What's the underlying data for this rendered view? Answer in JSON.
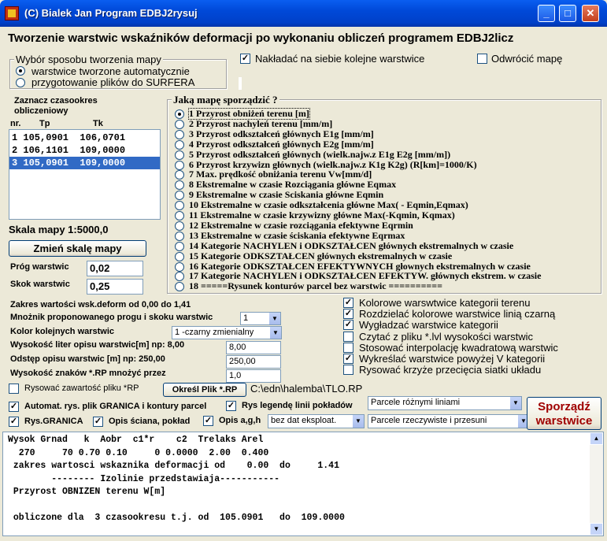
{
  "window": {
    "title": "(C) Bialek Jan Program EDBJ2rysuj",
    "min": "_",
    "max": "□",
    "close": "✕"
  },
  "heading": "Tworzenie warstwic wskaźników deformacji po wykonaniu obliczeń programem EDBJ2licz",
  "map_method": {
    "legend": "Wybór sposobu tworzenia mapy",
    "options": [
      "warstwice tworzone automatycznie",
      "przygotowanie plików do SURFERA"
    ],
    "selected": 0
  },
  "overlay_check": {
    "label": "Nakładać na siebie kolejne  warstwice",
    "checked": true
  },
  "flip_check": {
    "label": "Odwrócić mapę",
    "checked": false
  },
  "periods": {
    "label": "Zaznacz czasookres obliczeniowy",
    "headers": [
      "nr.",
      "Tp",
      "Tk"
    ],
    "rows": [
      "1 105,0901  106,0701",
      "2 106,1101  109,0000",
      "3 105,0901  109,0000"
    ],
    "selected": 2
  },
  "scale": {
    "label": "Skala mapy 1:5000,0",
    "button": "Zmień skalę mapy"
  },
  "threshold": {
    "label": "Próg warstwic",
    "value": "0,02"
  },
  "step": {
    "label": "Skok warstwic",
    "value": "0,25"
  },
  "map_type": {
    "legend": "Jaką mapę sporządzić ?",
    "options": [
      "1   Przyrost obniżeń terenu [m]",
      "2   Przyrost nachyleń terenu [mm/m]",
      "3   Przyrost odkształceń głównych E1g [mm/m]",
      "4   Przyrost odkształceń głównych E2g [mm/m]",
      "5   Przyrost odkształceń głównych (wielk.najw.z E1g E2g [mm/m])",
      "6   Przyrost krzywizn głównych (wielk.najw.z K1g K2g)           (R[km]=1000/K)",
      "7   Max. prędkość obniżania terenu Vw[mm/d]",
      "8   Ekstremalne w czasie Rozciągania główne Eqmax",
      "9   Ekstremalne w czasie Sciskania     główne Eqmin",
      "10 Ekstremalne w czasie odkształcenia główne    Max( - Eqmin,Eqmax)",
      "11 Ekstremalne w czasie krzywizny główne    Max(-Kqmin, Kqmax)",
      "12 Ekstremalne w czasie rozciągania efektywne Eqrmin",
      "13 Ekstremalne w  czasie  ściskania  efektywne  Eqrmax",
      "14 Kategorie NACHYLEN i ODKSZTAŁCEN głównych ekstremalnych w czasie",
      "15 Kategorie ODKSZTAŁCEN głównych ekstremalnych w czasie",
      "16 Kategorie ODKSZTAŁCEN EFEKTYWNYCH głownych ekstremalnych w czasie",
      "17 Kategorie NACHYLEN i ODKSZTAŁCEN EFEKTYW. głównych ekstrem. w czasie",
      "18 =====Rysunek konturów parcel bez warstwic =========="
    ],
    "selected": 0
  },
  "params": {
    "range_text": "Zakres wartości wsk.deform od 0,00 do 1,41",
    "multiplier_label": "Mnożnik proponowanego progu i skoku warstwic",
    "multiplier_value": "1",
    "color_label": "Kolor kolejnych warstwic",
    "color_value": "1 -czarny zmienialny",
    "letter_height_label": "Wysokość liter opisu warstwic[m] np: 8,00",
    "letter_height_value": "8,00",
    "desc_distance_label": "Odstęp opisu warstwic [m] np: 250,00",
    "desc_distance_value": "250,00",
    "char_height_label": "Wysokość znaków *.RP mnożyć przez",
    "char_height_value": "1,0"
  },
  "right_checks": [
    {
      "label": "Kolorowe warswtwice kategorii terenu",
      "checked": true
    },
    {
      "label": "Rozdzielać kolorowe warstwice linią czarną",
      "checked": true
    },
    {
      "label": "Wygładzać warstwice kategorii",
      "checked": true
    },
    {
      "label": "Czytać z pliku *.lvl wysokości warstwic",
      "checked": false
    },
    {
      "label": "Stosować interpolację kwadratową warstwic",
      "checked": false
    },
    {
      "label": "Wykreślać warstwice powyżej V kategorii",
      "checked": true
    },
    {
      "label": "Rysować krzyże przecięcia siatki układu",
      "checked": false
    }
  ],
  "rp": {
    "label": "Rysować zawartość pliku *RP",
    "checked": false,
    "button": "Określ Plik *.RP",
    "path": "C:\\edn\\halemba\\TLO.RP"
  },
  "bottom": {
    "granica": {
      "label": "Automat. rys. plik GRANICA i kontury parcel",
      "checked": true
    },
    "legend": {
      "label": "Rys legendę linii pokładów",
      "checked": true
    },
    "parcels_lines": "Parcele różnymi liniami",
    "rys_granica": {
      "label": "Rys.GRANICA",
      "checked": true
    },
    "opis_sciana": {
      "label": "Opis ściana, pokład",
      "checked": true
    },
    "opis_agh": {
      "label": "Opis a,g,h",
      "checked": true
    },
    "exploit": "bez dat eksploat.",
    "parcels_real": "Parcele rzeczywiste i przesuni",
    "make_button_line1": "Sporządź",
    "make_button_line2": "warstwice"
  },
  "output": [
    "Wysok Grnad   k  Aobr  c1*r    c2  Trelaks Arel",
    "  270     70 0.70 0.10     0 0.0000  2.00  0.400",
    " zakres wartosci wskaznika deformacji od    0.00  do     1.41",
    "        -------- Izolinie przedstawiaja-----------",
    " Przyrost OBNIZEN terenu W[m]",
    "",
    " obliczone dla  3 czasookresu t.j. od  105.0901   do  109.0000"
  ],
  "colors": {
    "accent": "#a00000",
    "selection": "#316ac5",
    "titlebar": "#0054e3"
  }
}
